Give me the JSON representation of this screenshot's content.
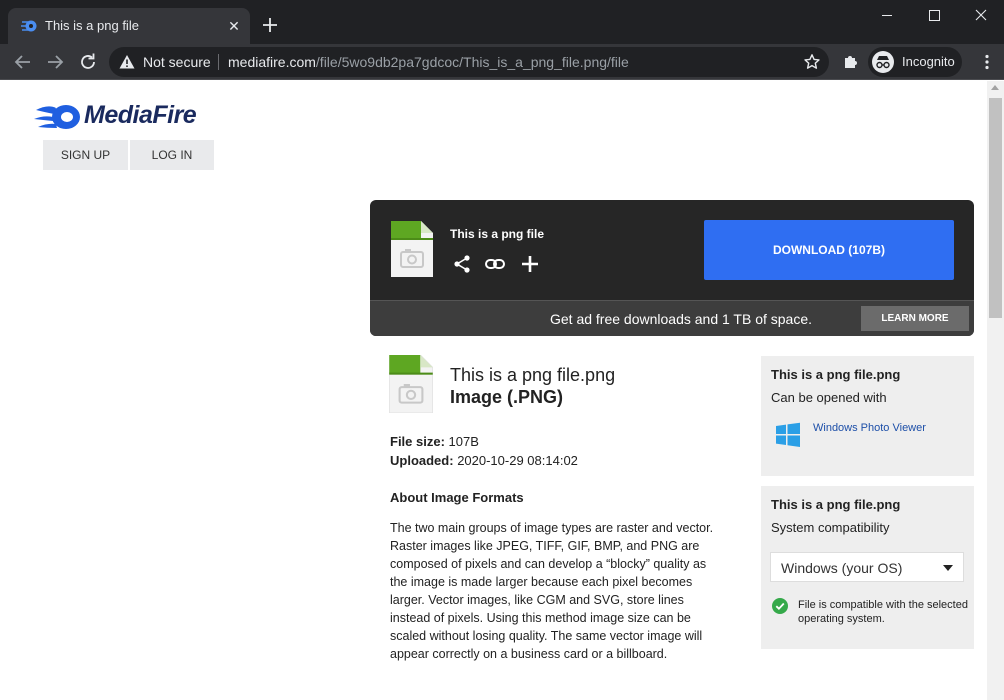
{
  "browser": {
    "tab_title": "This is a png file",
    "security_label": "Not secure",
    "url_host": "mediafire.com",
    "url_path": "/file/5wo9db2pa7gdcoc/This_is_a_png_file.png/file",
    "profile_label": "Incognito",
    "tab_close_glyph": "✕"
  },
  "site": {
    "logo_text": "MediaFire",
    "signup_label": "SIGN UP",
    "login_label": "LOG IN",
    "brand_color": "#1a2a5e",
    "accent_color": "#2f6ef2"
  },
  "download_panel": {
    "title": "This is a png file",
    "download_label": "DOWNLOAD (107B)",
    "promo_text": "Get ad free downloads and 1 TB of space.",
    "learn_more_label": "LEARN MORE",
    "actions": [
      "share-icon",
      "link-icon",
      "plus-icon"
    ]
  },
  "file": {
    "name": "This is a png file.png",
    "type": "Image (.PNG)",
    "size_label": "File size:",
    "size_value": "107B",
    "uploaded_label": "Uploaded:",
    "uploaded_value": "2020-10-29 08:14:02"
  },
  "about": {
    "title": "About Image Formats",
    "body": "The two main groups of image types are raster and vector. Raster images like JPEG, TIFF, GIF, BMP, and PNG are composed of pixels and can develop a “blocky” quality as the image is made larger because each pixel becomes larger. Vector images, like CGM and SVG, store lines instead of pixels. Using this method image size can be scaled without losing quality. The same vector image will appear correctly on a business card or a billboard."
  },
  "sidebar": {
    "open_with": {
      "title": "This is a png file.png",
      "subtitle": "Can be opened with",
      "app_name": "Windows Photo Viewer"
    },
    "compatibility": {
      "title": "This is a png file.png",
      "subtitle": "System compatibility",
      "selected_os": "Windows (your OS)",
      "status_text": "File is compatible with the selected operating system.",
      "status_color": "#35a94a"
    }
  }
}
